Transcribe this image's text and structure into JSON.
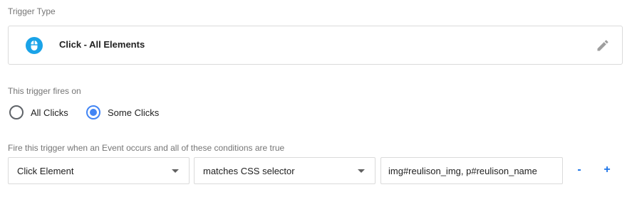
{
  "trigger_type": {
    "label": "Trigger Type",
    "name": "Click - All Elements",
    "icon": "mouse-icon",
    "edit_icon": "pencil-icon"
  },
  "fires_on": {
    "label": "This trigger fires on",
    "options": [
      {
        "label": "All Clicks",
        "selected": false
      },
      {
        "label": "Some Clicks",
        "selected": true
      }
    ]
  },
  "conditions": {
    "label": "Fire this trigger when an Event occurs and all of these conditions are true",
    "rows": [
      {
        "variable": "Click Element",
        "operator": "matches CSS selector",
        "value": "img#reulison_img, p#reulison_name"
      }
    ],
    "remove_label": "-",
    "add_label": "+"
  },
  "colors": {
    "accent": "#4285f4",
    "icon_bg": "#1aa3e8",
    "action": "#1a73e8"
  }
}
